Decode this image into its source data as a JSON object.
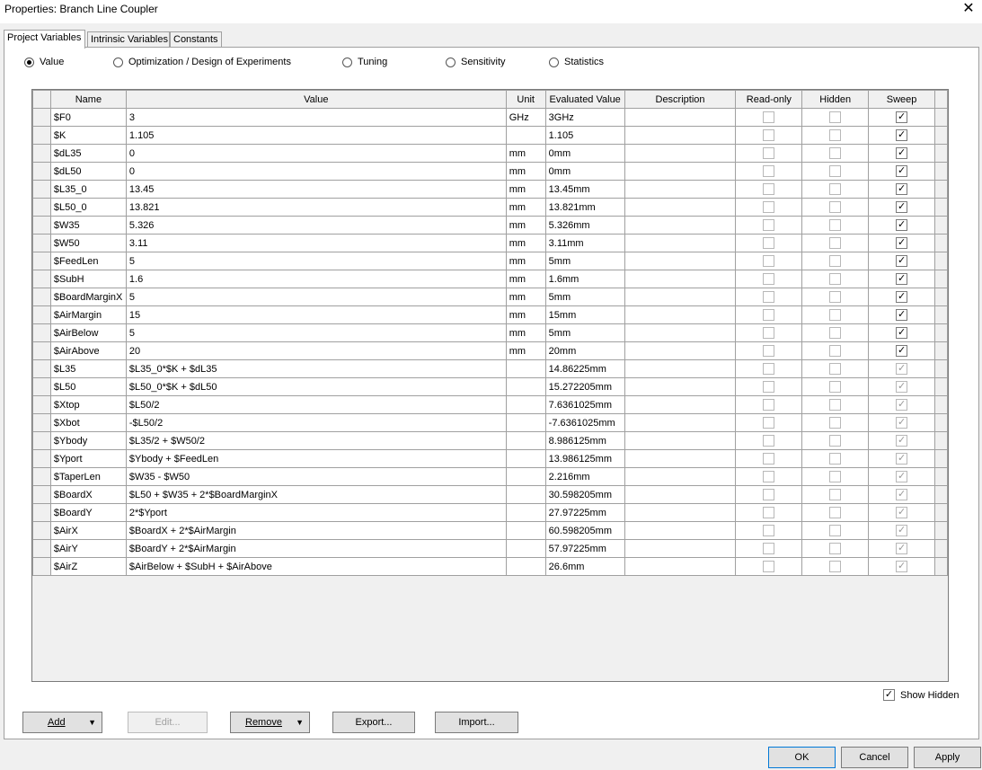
{
  "window": {
    "title": "Properties: Branch Line Coupler",
    "close": "✕"
  },
  "tabs": [
    "Project Variables",
    "Intrinsic Variables",
    "Constants"
  ],
  "modes": {
    "options": [
      "Value",
      "Optimization / Design of Experiments",
      "Tuning",
      "Sensitivity",
      "Statistics"
    ],
    "selected": "Value"
  },
  "table": {
    "columns": [
      "Name",
      "Value",
      "Unit",
      "Evaluated Value",
      "Description",
      "Read-only",
      "Hidden",
      "Sweep"
    ],
    "rows": [
      {
        "name": "$F0",
        "value": "3",
        "unit": "GHz",
        "evaluated": "3GHz",
        "description": "",
        "readonly": false,
        "hidden": false,
        "sweep": true,
        "sweep_enabled": true
      },
      {
        "name": "$K",
        "value": "1.105",
        "unit": "",
        "evaluated": "1.105",
        "description": "",
        "readonly": false,
        "hidden": false,
        "sweep": true,
        "sweep_enabled": true
      },
      {
        "name": "$dL35",
        "value": "0",
        "unit": "mm",
        "evaluated": "0mm",
        "description": "",
        "readonly": false,
        "hidden": false,
        "sweep": true,
        "sweep_enabled": true
      },
      {
        "name": "$dL50",
        "value": "0",
        "unit": "mm",
        "evaluated": "0mm",
        "description": "",
        "readonly": false,
        "hidden": false,
        "sweep": true,
        "sweep_enabled": true
      },
      {
        "name": "$L35_0",
        "value": "13.45",
        "unit": "mm",
        "evaluated": "13.45mm",
        "description": "",
        "readonly": false,
        "hidden": false,
        "sweep": true,
        "sweep_enabled": true
      },
      {
        "name": "$L50_0",
        "value": "13.821",
        "unit": "mm",
        "evaluated": "13.821mm",
        "description": "",
        "readonly": false,
        "hidden": false,
        "sweep": true,
        "sweep_enabled": true
      },
      {
        "name": "$W35",
        "value": "5.326",
        "unit": "mm",
        "evaluated": "5.326mm",
        "description": "",
        "readonly": false,
        "hidden": false,
        "sweep": true,
        "sweep_enabled": true
      },
      {
        "name": "$W50",
        "value": "3.11",
        "unit": "mm",
        "evaluated": "3.11mm",
        "description": "",
        "readonly": false,
        "hidden": false,
        "sweep": true,
        "sweep_enabled": true
      },
      {
        "name": "$FeedLen",
        "value": "5",
        "unit": "mm",
        "evaluated": "5mm",
        "description": "",
        "readonly": false,
        "hidden": false,
        "sweep": true,
        "sweep_enabled": true
      },
      {
        "name": "$SubH",
        "value": "1.6",
        "unit": "mm",
        "evaluated": "1.6mm",
        "description": "",
        "readonly": false,
        "hidden": false,
        "sweep": true,
        "sweep_enabled": true
      },
      {
        "name": "$BoardMarginX",
        "value": "5",
        "unit": "mm",
        "evaluated": "5mm",
        "description": "",
        "readonly": false,
        "hidden": false,
        "sweep": true,
        "sweep_enabled": true
      },
      {
        "name": "$AirMargin",
        "value": "15",
        "unit": "mm",
        "evaluated": "15mm",
        "description": "",
        "readonly": false,
        "hidden": false,
        "sweep": true,
        "sweep_enabled": true
      },
      {
        "name": "$AirBelow",
        "value": "5",
        "unit": "mm",
        "evaluated": "5mm",
        "description": "",
        "readonly": false,
        "hidden": false,
        "sweep": true,
        "sweep_enabled": true
      },
      {
        "name": "$AirAbove",
        "value": "20",
        "unit": "mm",
        "evaluated": "20mm",
        "description": "",
        "readonly": false,
        "hidden": false,
        "sweep": true,
        "sweep_enabled": true
      },
      {
        "name": "$L35",
        "value": "$L35_0*$K + $dL35",
        "unit": "",
        "evaluated": "14.86225mm",
        "description": "",
        "readonly": false,
        "hidden": false,
        "sweep": true,
        "sweep_enabled": false
      },
      {
        "name": "$L50",
        "value": "$L50_0*$K + $dL50",
        "unit": "",
        "evaluated": "15.272205mm",
        "description": "",
        "readonly": false,
        "hidden": false,
        "sweep": true,
        "sweep_enabled": false
      },
      {
        "name": "$Xtop",
        "value": "$L50/2",
        "unit": "",
        "evaluated": "7.6361025mm",
        "description": "",
        "readonly": false,
        "hidden": false,
        "sweep": true,
        "sweep_enabled": false
      },
      {
        "name": "$Xbot",
        "value": "-$L50/2",
        "unit": "",
        "evaluated": "-7.6361025mm",
        "description": "",
        "readonly": false,
        "hidden": false,
        "sweep": true,
        "sweep_enabled": false
      },
      {
        "name": "$Ybody",
        "value": "$L35/2 + $W50/2",
        "unit": "",
        "evaluated": "8.986125mm",
        "description": "",
        "readonly": false,
        "hidden": false,
        "sweep": true,
        "sweep_enabled": false
      },
      {
        "name": "$Yport",
        "value": "$Ybody + $FeedLen",
        "unit": "",
        "evaluated": "13.986125mm",
        "description": "",
        "readonly": false,
        "hidden": false,
        "sweep": true,
        "sweep_enabled": false
      },
      {
        "name": "$TaperLen",
        "value": "$W35 - $W50",
        "unit": "",
        "evaluated": "2.216mm",
        "description": "",
        "readonly": false,
        "hidden": false,
        "sweep": true,
        "sweep_enabled": false
      },
      {
        "name": "$BoardX",
        "value": "$L50 + $W35 + 2*$BoardMarginX",
        "unit": "",
        "evaluated": "30.598205mm",
        "description": "",
        "readonly": false,
        "hidden": false,
        "sweep": true,
        "sweep_enabled": false
      },
      {
        "name": "$BoardY",
        "value": "2*$Yport",
        "unit": "",
        "evaluated": "27.97225mm",
        "description": "",
        "readonly": false,
        "hidden": false,
        "sweep": true,
        "sweep_enabled": false
      },
      {
        "name": "$AirX",
        "value": "$BoardX + 2*$AirMargin",
        "unit": "",
        "evaluated": "60.598205mm",
        "description": "",
        "readonly": false,
        "hidden": false,
        "sweep": true,
        "sweep_enabled": false
      },
      {
        "name": "$AirY",
        "value": "$BoardY + 2*$AirMargin",
        "unit": "",
        "evaluated": "57.97225mm",
        "description": "",
        "readonly": false,
        "hidden": false,
        "sweep": true,
        "sweep_enabled": false
      },
      {
        "name": "$AirZ",
        "value": "$AirBelow + $SubH + $AirAbove",
        "unit": "",
        "evaluated": "26.6mm",
        "description": "",
        "readonly": false,
        "hidden": false,
        "sweep": true,
        "sweep_enabled": false
      }
    ]
  },
  "show_hidden": {
    "label": "Show Hidden",
    "checked": true
  },
  "buttons": {
    "add": "Add",
    "edit": "Edit...",
    "remove": "Remove",
    "export": "Export...",
    "import": "Import...",
    "ok": "OK",
    "cancel": "Cancel",
    "apply": "Apply"
  },
  "glyphs": {
    "check": "✓",
    "dropdown": "▼"
  }
}
